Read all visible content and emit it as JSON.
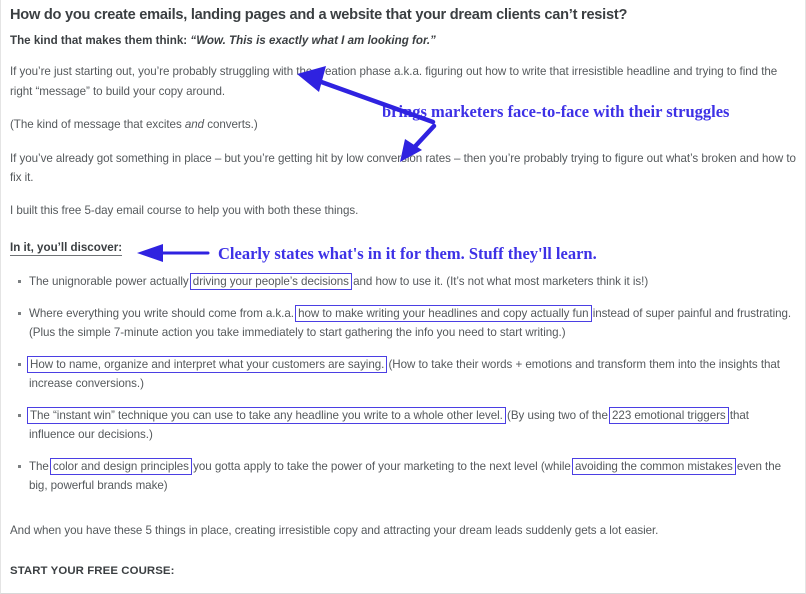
{
  "page": {
    "headline": "How do you create emails, landing pages and a website that your dream clients can’t resist?",
    "subhead_lead": "The kind that makes them think: ",
    "subhead_quote": "“Wow. This is exactly what I am looking for.”",
    "para_1": "If you’re just starting out, you’re probably struggling with the creation phase a.k.a. figuring out how to write that irresistible headline and trying to find the right “message” to build your copy around.",
    "para_2_a": "(The kind of message that excites ",
    "para_2_em": "and",
    "para_2_b": " converts.)",
    "para_3": "If you’ve already got something in place – but you’re getting hit by low conversion rates – then you’re probably trying to figure out what’s broken and how to fix it.",
    "para_4": "I built this free 5-day email course to help you with both these things.",
    "discover_label": "In it, you’ll discover:",
    "outro": "And when you have these 5 things in place, creating irresistible copy and attracting your dream leads suddenly gets a lot easier.",
    "cta_label": "START YOUR FREE COURSE:"
  },
  "bullets": [
    {
      "pre": "The unignorable power actually ",
      "boxed": "driving your people’s decisions",
      "post": " and how to use it. (It’s not what most marketers think it is!)"
    },
    {
      "pre": "Where everything you write should come from a.k.a. ",
      "boxed": "how to make writing your headlines and copy actually fun",
      "post": " instead of super painful and frustrating. (Plus the simple 7-minute action you take immediately to start gathering the info you need to start writing.)"
    },
    {
      "pre": "",
      "boxed": "How to name, organize and interpret what your customers are saying.",
      "post": " (How to take their words + emotions and transform them into the insights that increase conversions.)"
    },
    {
      "pre": "",
      "boxed": "The “instant win” technique you can use to take any headline you write to a whole other level.",
      "mid": " (By using two of the ",
      "boxed2": "223 emotional triggers",
      "post": " that influence our decisions.)"
    },
    {
      "pre": "The ",
      "boxed": "color and design principles",
      "mid": " you gotta apply to take the power of your marketing to the next level (while ",
      "boxed2": "avoiding the common mistakes",
      "post": " even the big, powerful brands make)"
    }
  ],
  "annotations": {
    "note_1": "brings marketers face-to-face with their struggles",
    "note_2": "Clearly states what's in it for them. Stuff they'll learn.",
    "color": "#3d31e6",
    "highlight_box_color": "#4b3fe3"
  }
}
